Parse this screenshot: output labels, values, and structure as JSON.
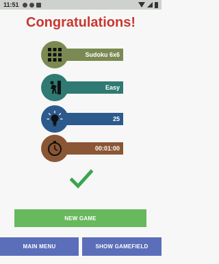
{
  "status_bar": {
    "time": "11:51"
  },
  "title": "Congratulations!",
  "stats": [
    {
      "icon": "sudoku-grid-icon",
      "value": "Sudoku 6x6",
      "bar_color": "#7a8a52",
      "circle_color": "#7a8a52"
    },
    {
      "icon": "difficulty-climber-icon",
      "value": "Easy",
      "bar_color": "#2f7a72",
      "circle_color": "#2f7a72"
    },
    {
      "icon": "lightbulb-hint-icon",
      "value": "25",
      "bar_color": "#2c5a8c",
      "circle_color": "#2c5a8c"
    },
    {
      "icon": "stopwatch-icon",
      "value": "00:01:00",
      "bar_color": "#8a5634",
      "circle_color": "#8a5634"
    }
  ],
  "buttons": {
    "new_game": "NEW GAME",
    "main_menu": "MAIN MENU",
    "show_gamefield": "SHOW GAMEFIELD"
  },
  "colors": {
    "title": "#c8372f",
    "check": "#3aa64f",
    "new_game": "#68b85d",
    "nav": "#5b6eb9"
  }
}
